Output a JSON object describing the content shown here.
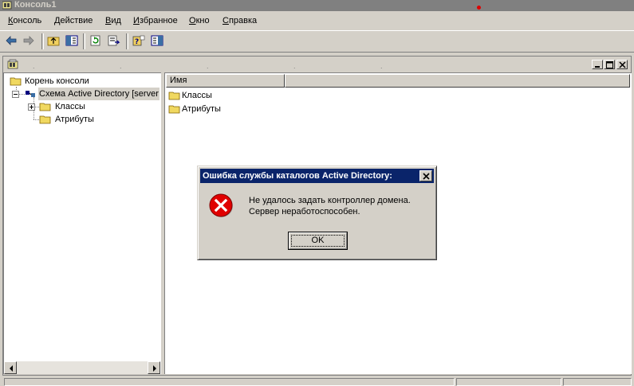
{
  "window": {
    "title": "Консоль1"
  },
  "menu": [
    {
      "label": "Консоль",
      "accel": "К"
    },
    {
      "label": "Действие",
      "accel": "Д"
    },
    {
      "label": "Вид",
      "accel": "В"
    },
    {
      "label": "Избранное",
      "accel": "И"
    },
    {
      "label": "Окно",
      "accel": "О"
    },
    {
      "label": "Справка",
      "accel": "С"
    }
  ],
  "toolbar": {
    "buttons": [
      "back-arrow-icon",
      "forward-arrow-icon",
      "up-folder-icon",
      "show-hide-tree-icon",
      "refresh-icon",
      "export-list-icon",
      "help-icon",
      "show-action-pane-icon"
    ]
  },
  "tree": {
    "root_label": "Корень консоли",
    "schema_label": "Схема Active Directory [server",
    "classes_label": "Классы",
    "attributes_label": "Атрибуты"
  },
  "list": {
    "column_name": "Имя",
    "items": [
      "Классы",
      "Атрибуты"
    ]
  },
  "dialog": {
    "title": "Ошибка службы каталогов Active Directory:",
    "message_line1": "Не удалось задать контроллер домена.",
    "message_line2": "Сервер неработоспособен.",
    "ok_label": "OK"
  },
  "colors": {
    "face": "#d4d0c8",
    "dialog_title_bg": "#0a246a",
    "error_red": "#e00000"
  }
}
